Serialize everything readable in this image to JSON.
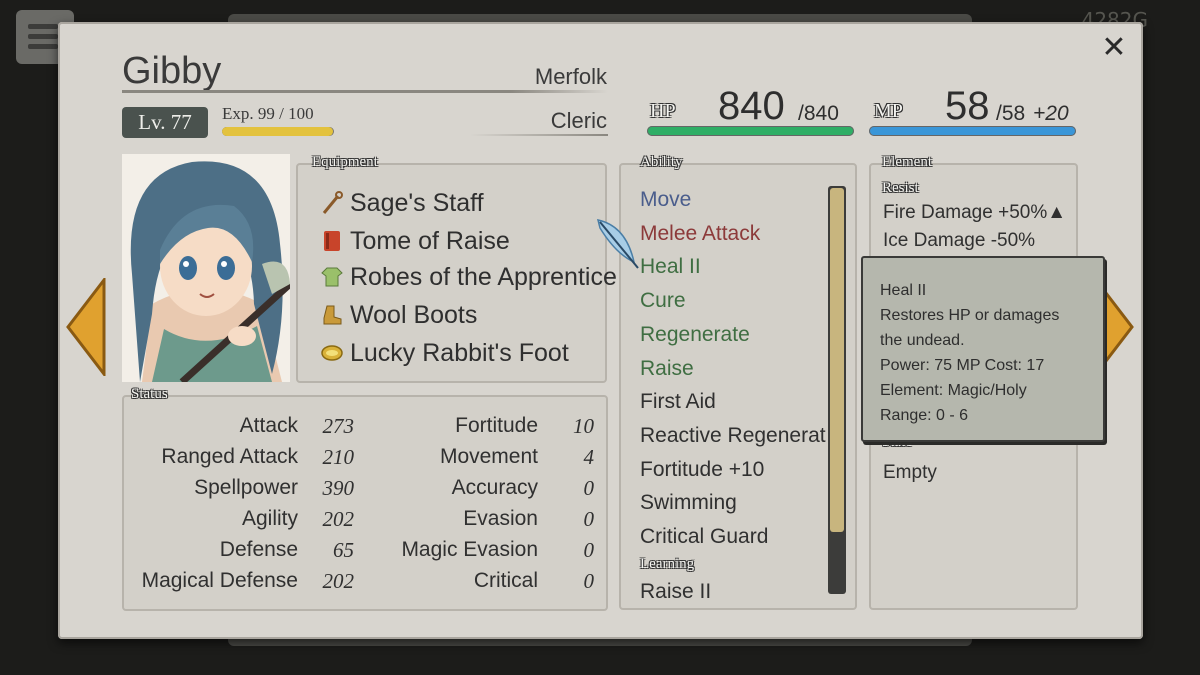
{
  "background": {
    "gold": "4282G"
  },
  "character": {
    "name": "Gibby",
    "race": "Merfolk",
    "class": "Cleric",
    "level": "Lv. 77",
    "exp_label": "Exp. 99 / 100",
    "exp_fraction": 0.99
  },
  "hp": {
    "label": "HP",
    "current": "840",
    "max": "/840",
    "fraction": 1.0,
    "color": "#2fae66"
  },
  "mp": {
    "label": "MP",
    "current": "58",
    "max": "/58",
    "bonus": "+20",
    "fraction": 1.0,
    "color": "#3a96d8"
  },
  "equipment": {
    "label": "Equipment",
    "items": [
      {
        "name": "Sage's Staff",
        "icon": "staff-icon"
      },
      {
        "name": "Tome of Raise",
        "icon": "book-icon"
      },
      {
        "name": "Robes of the Apprentice",
        "icon": "robe-icon"
      },
      {
        "name": "Wool Boots",
        "icon": "boots-icon"
      },
      {
        "name": "Lucky Rabbit's Foot",
        "icon": "ring-icon"
      }
    ]
  },
  "status": {
    "label": "Status",
    "left": [
      {
        "label": "Attack",
        "value": "273"
      },
      {
        "label": "Ranged Attack",
        "value": "210"
      },
      {
        "label": "Spellpower",
        "value": "390"
      },
      {
        "label": "Agility",
        "value": "202"
      },
      {
        "label": "Defense",
        "value": "65"
      },
      {
        "label": "Magical Defense",
        "value": "202"
      }
    ],
    "right": [
      {
        "label": "Fortitude",
        "value": "10"
      },
      {
        "label": "Movement",
        "value": "4"
      },
      {
        "label": "Accuracy",
        "value": "0"
      },
      {
        "label": "Evasion",
        "value": "0"
      },
      {
        "label": "Magic Evasion",
        "value": "0"
      },
      {
        "label": "Critical",
        "value": "0"
      }
    ]
  },
  "ability": {
    "label": "Ability",
    "items": [
      {
        "name": "Move",
        "color": "#4a5d8c"
      },
      {
        "name": "Melee Attack",
        "color": "#8c3a3a"
      },
      {
        "name": "Heal II",
        "color": "#3f6e42"
      },
      {
        "name": "Cure",
        "color": "#3f6e42"
      },
      {
        "name": "Regenerate",
        "color": "#3f6e42"
      },
      {
        "name": "Raise",
        "color": "#3f6e42"
      },
      {
        "name": "First Aid",
        "color": "#303030"
      },
      {
        "name": "Reactive Regenerat",
        "color": "#303030"
      },
      {
        "name": "Fortitude +10",
        "color": "#303030"
      },
      {
        "name": "Swimming",
        "color": "#303030"
      },
      {
        "name": "Critical Guard",
        "color": "#303030"
      }
    ],
    "learning_label": "Learning",
    "learning_items": [
      "Raise II"
    ]
  },
  "element": {
    "label": "Element",
    "resist_label": "Resist",
    "resist": [
      "Fire Damage +50%▲",
      "Ice Damage -50%"
    ],
    "state_label": "State",
    "state": "Empty"
  },
  "tooltip": {
    "title": "Heal II",
    "desc1": "Restores HP or damages",
    "desc2": "the undead.",
    "power": "Power: 75  MP Cost: 17",
    "element": "Element: Magic/Holy",
    "range": "Range: 0 - 6"
  },
  "colors": {
    "arrow": "#e0a12f",
    "dialog": "#d8d5cf",
    "level_badge": "#4a524e"
  }
}
